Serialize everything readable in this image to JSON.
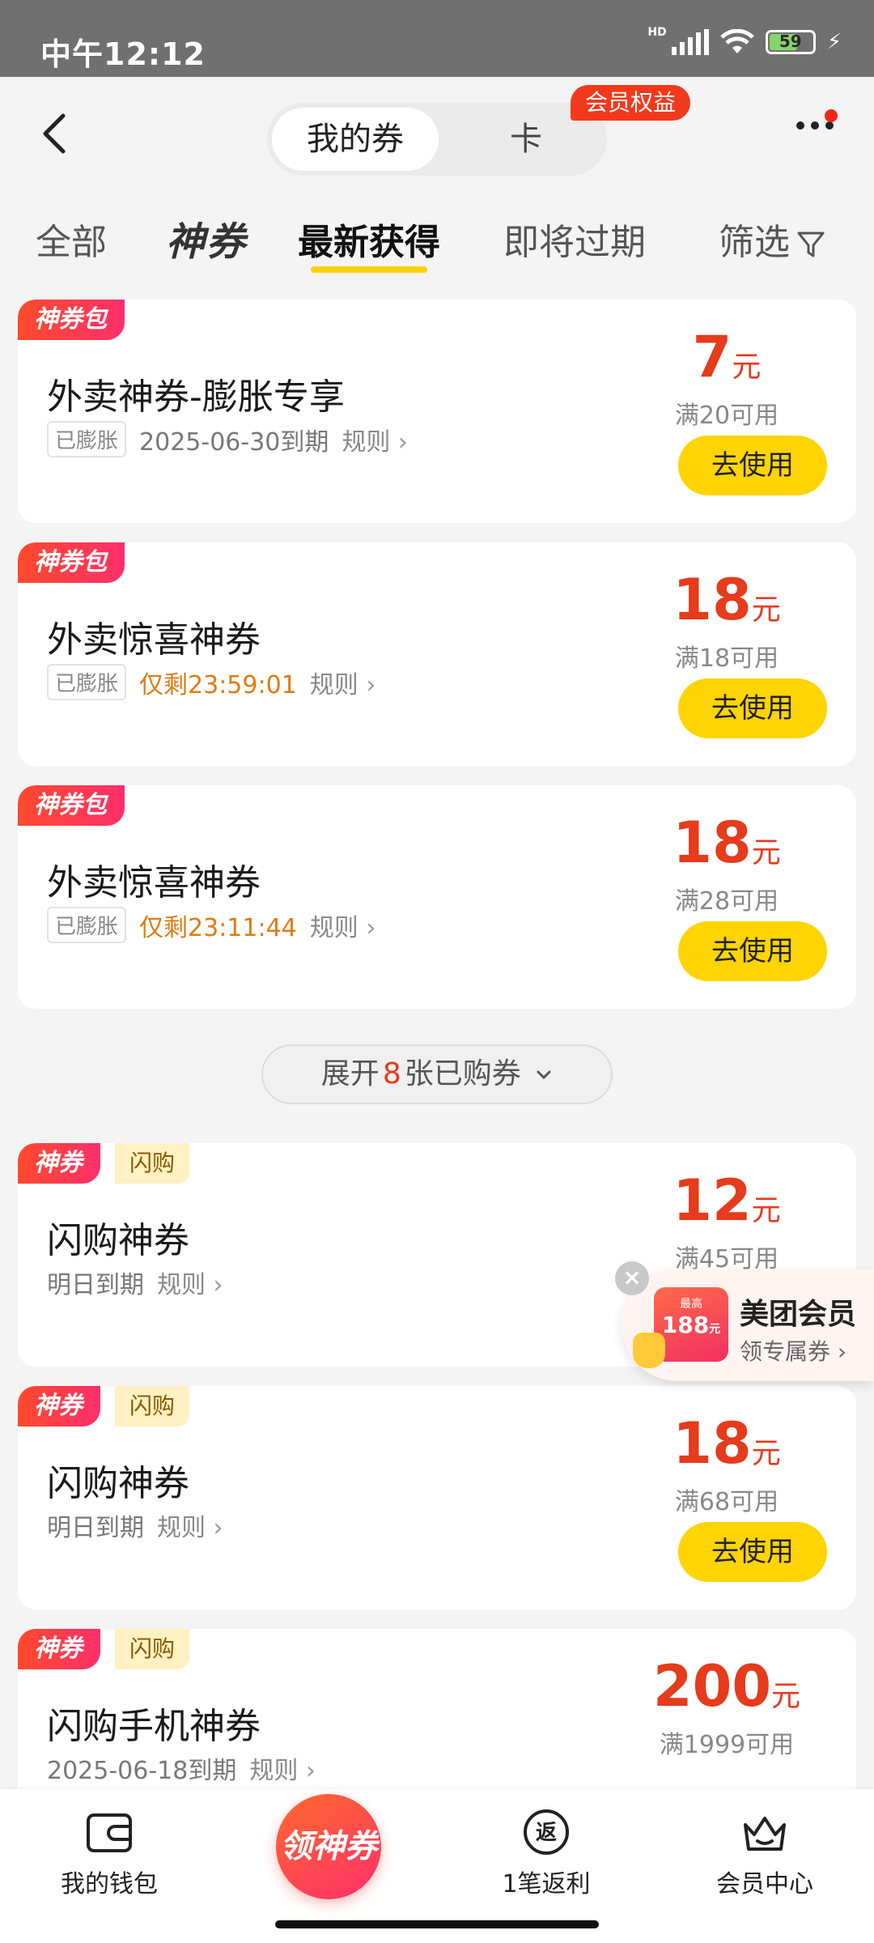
{
  "status_bar": {
    "time": "中午12:12",
    "network": "HD",
    "battery": "59"
  },
  "header": {
    "segments": [
      "我的券",
      "卡"
    ],
    "active_segment": "我的券",
    "vip_badge": "会员权益"
  },
  "filter_tabs": {
    "all": "全部",
    "brand": "神券",
    "latest": "最新获得",
    "expiring": "即将过期",
    "filter": "筛选",
    "active": "最新获得"
  },
  "coupons": [
    {
      "tag": "神券包",
      "title": "外卖神券-膨胀专享",
      "chip": "已膨胀",
      "expiry": "2025-06-30到期",
      "rule": "规则",
      "price": "7",
      "unit": "元",
      "condition": "满20可用",
      "button": "去使用"
    },
    {
      "tag": "神券包",
      "title": "外卖惊喜神券",
      "chip": "已膨胀",
      "countdown": "仅剩23:59:01",
      "rule": "规则",
      "price": "18",
      "unit": "元",
      "condition": "满18可用",
      "button": "去使用"
    },
    {
      "tag": "神券包",
      "title": "外卖惊喜神券",
      "chip": "已膨胀",
      "countdown": "仅剩23:11:44",
      "rule": "规则",
      "price": "18",
      "unit": "元",
      "condition": "满28可用",
      "button": "去使用"
    }
  ],
  "expand": {
    "prefix": "展开",
    "count": "8",
    "suffix": "张已购券"
  },
  "flash_coupons": [
    {
      "tag": "神券",
      "subtag": "闪购",
      "title": "闪购神券",
      "expiry": "明日到期",
      "rule": "规则",
      "price": "12",
      "unit": "元",
      "condition": "满45可用"
    },
    {
      "tag": "神券",
      "subtag": "闪购",
      "title": "闪购神券",
      "expiry": "明日到期",
      "rule": "规则",
      "price": "18",
      "unit": "元",
      "condition": "满68可用",
      "button": "去使用"
    },
    {
      "tag": "神券",
      "subtag": "闪购",
      "title": "闪购手机神券",
      "expiry": "2025-06-18到期",
      "rule": "规则",
      "price": "200",
      "unit": "元",
      "condition": "满1999可用"
    }
  ],
  "floating_member": {
    "img_top": "最高",
    "img_value": "188",
    "img_unit": "元",
    "title": "美团会员",
    "subtitle": "领专属券"
  },
  "bottom_nav": {
    "wallet": "我的钱包",
    "center": "领神券",
    "rebate": "1笔返利",
    "member": "会员中心"
  }
}
